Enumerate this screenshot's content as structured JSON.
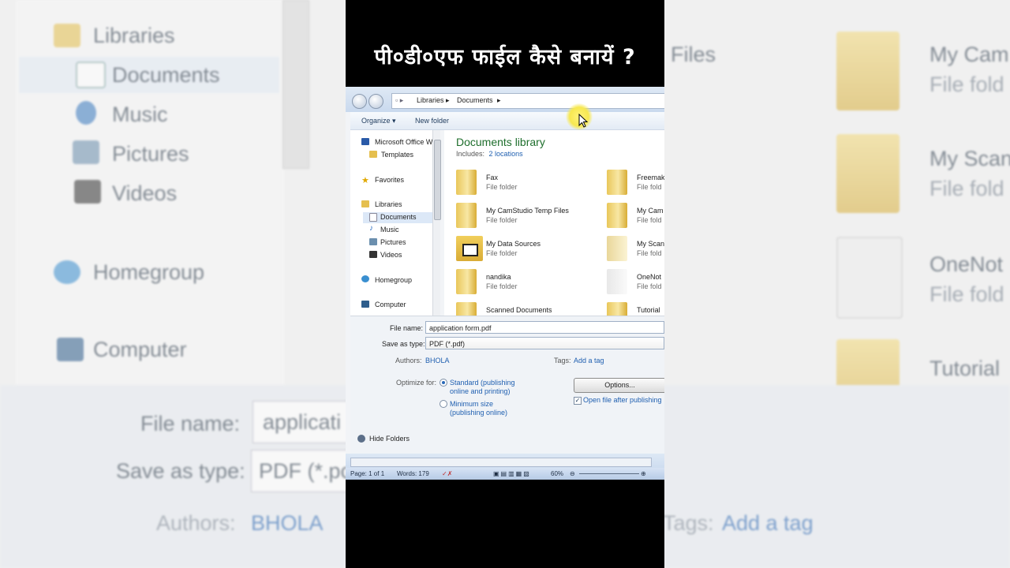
{
  "caption": "पी०डी०एफ फाईल कैसे बनायें ?",
  "dialog": {
    "breadcrumb": [
      "Libraries",
      "Documents"
    ],
    "toolbar": {
      "organize": "Organize ▾",
      "new_folder": "New folder"
    },
    "nav": {
      "office": "Microsoft Office W",
      "templates": "Templates",
      "favorites": "Favorites",
      "libraries": "Libraries",
      "documents": "Documents",
      "music": "Music",
      "pictures": "Pictures",
      "videos": "Videos",
      "homegroup": "Homegroup",
      "computer": "Computer"
    },
    "library": {
      "title": "Documents library",
      "includes_label": "Includes:",
      "locations": "2 locations"
    },
    "folders_left": [
      {
        "name": "Fax",
        "type": "File folder"
      },
      {
        "name": "My CamStudio Temp Files",
        "type": "File folder"
      },
      {
        "name": "My Data Sources",
        "type": "File folder"
      },
      {
        "name": "nandika",
        "type": "File folder"
      },
      {
        "name": "Scanned Documents",
        "type": ""
      }
    ],
    "folders_right": [
      {
        "name": "Freemak",
        "type": "File fold"
      },
      {
        "name": "My Cam",
        "type": "File fold"
      },
      {
        "name": "My Scan",
        "type": "File fold"
      },
      {
        "name": "OneNot",
        "type": "File fold"
      },
      {
        "name": "Tutorial",
        "type": ""
      }
    ],
    "form": {
      "file_name_label": "File name:",
      "file_name_value": "application form.pdf",
      "save_type_label": "Save as type:",
      "save_type_value": "PDF (*.pdf)",
      "authors_label": "Authors:",
      "authors_value": "BHOLA",
      "tags_label": "Tags:",
      "tags_value": "Add a tag",
      "optimize_label": "Optimize for:",
      "opt_standard": "Standard (publishing",
      "opt_standard_2": "online and printing)",
      "opt_minimum": "Minimum size",
      "opt_minimum_2": "(publishing online)",
      "options_button": "Options...",
      "open_after": "Open file after publishing",
      "hide_folders": "Hide Folders"
    },
    "status": {
      "page": "Page: 1 of 1",
      "words": "Words: 179",
      "zoom": "60%"
    }
  },
  "background": {
    "nav": [
      "Libraries",
      "Documents",
      "Music",
      "Pictures",
      "Videos",
      "Homegroup",
      "Computer"
    ],
    "files_header": "Files",
    "folders": [
      {
        "name": "My Cam",
        "type": "File fold"
      },
      {
        "name": "My Scan",
        "type": "File fold"
      },
      {
        "name": "OneNot",
        "type": "File fold"
      },
      {
        "name": "Tutorial",
        "type": ""
      }
    ],
    "file_name_label": "File name:",
    "file_name_value": "applicati",
    "save_type_label": "Save as type:",
    "save_type_value": "PDF (*.pc",
    "authors_label": "Authors:",
    "authors_value": "BHOLA",
    "tags_label": "Tags:",
    "tags_value": "Add a tag"
  }
}
